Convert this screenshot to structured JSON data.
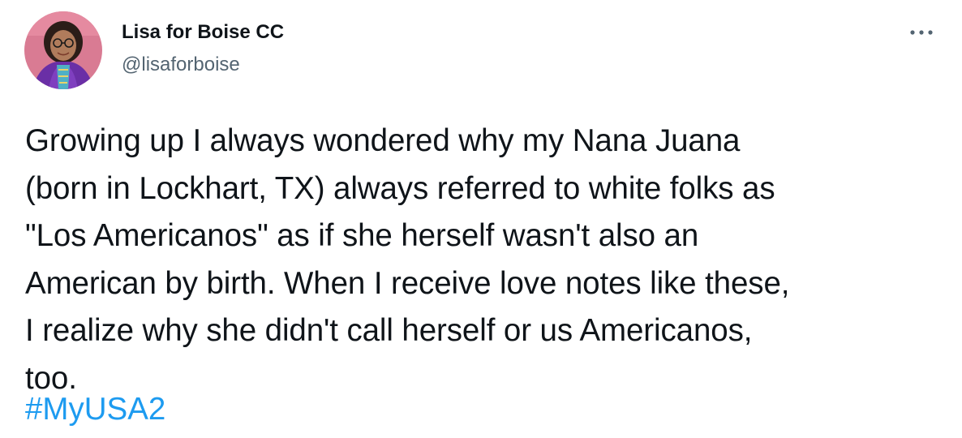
{
  "author": {
    "name": "Lisa for Boise CC",
    "handle": "@lisaforboise"
  },
  "icons": {
    "avatar": "profile-photo",
    "more": "more-horizontal-icon"
  },
  "tweet": {
    "text": "Growing up I always wondered why my Nana Juana\n(born in Lockhart, TX) always referred to white folks as\n\"Los Americanos\" as if she herself wasn't also an\nAmerican by birth. When I receive love notes like these,\nI realize why she didn't call herself or us Americanos,\ntoo.",
    "hashtag": "#MyUSA2"
  },
  "colors": {
    "text": "#0f1419",
    "secondary": "#536471",
    "link": "#1d9bf0",
    "background": "#ffffff"
  }
}
